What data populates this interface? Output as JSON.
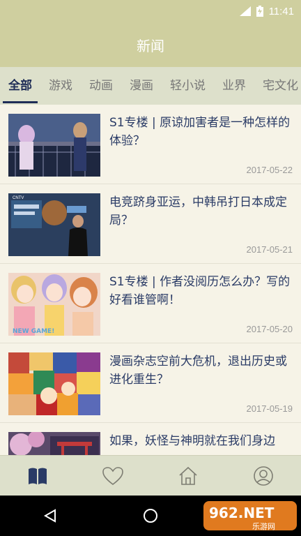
{
  "status": {
    "time": "11:41"
  },
  "app": {
    "title": "新闻"
  },
  "tabs": [
    {
      "label": "全部",
      "active": true
    },
    {
      "label": "游戏"
    },
    {
      "label": "动画"
    },
    {
      "label": "漫画"
    },
    {
      "label": "轻小说"
    },
    {
      "label": "业界"
    },
    {
      "label": "宅文化"
    }
  ],
  "news": [
    {
      "title": "S1专楼 | 原谅加害者是一种怎样的体验？",
      "date": "2017-05-22"
    },
    {
      "title": "电竞跻身亚运，中韩吊打日本成定局？",
      "date": "2017-05-21"
    },
    {
      "title": "S1专楼 | 作者没阅历怎么办？写的好看谁管啊！",
      "date": "2017-05-20"
    },
    {
      "title": "漫画杂志空前大危机，退出历史或进化重生？",
      "date": "2017-05-19"
    },
    {
      "title": "如果，妖怪与神明就在我们身边",
      "date": ""
    }
  ],
  "thumbs": {
    "t1_caption": "",
    "t2_caption": "CNTV",
    "t3_caption": "NEW GAME!"
  },
  "bottom_nav": [
    {
      "icon": "book-icon",
      "active": true
    },
    {
      "icon": "heart-icon"
    },
    {
      "icon": "home-icon"
    },
    {
      "icon": "user-icon"
    }
  ],
  "watermark": {
    "text": "962.NET",
    "sub": "乐游网"
  },
  "colors": {
    "header": "#cfcf9f",
    "tabs_bg": "#dde0cb",
    "active": "#1f2d57",
    "title_text": "#2a3b66"
  }
}
